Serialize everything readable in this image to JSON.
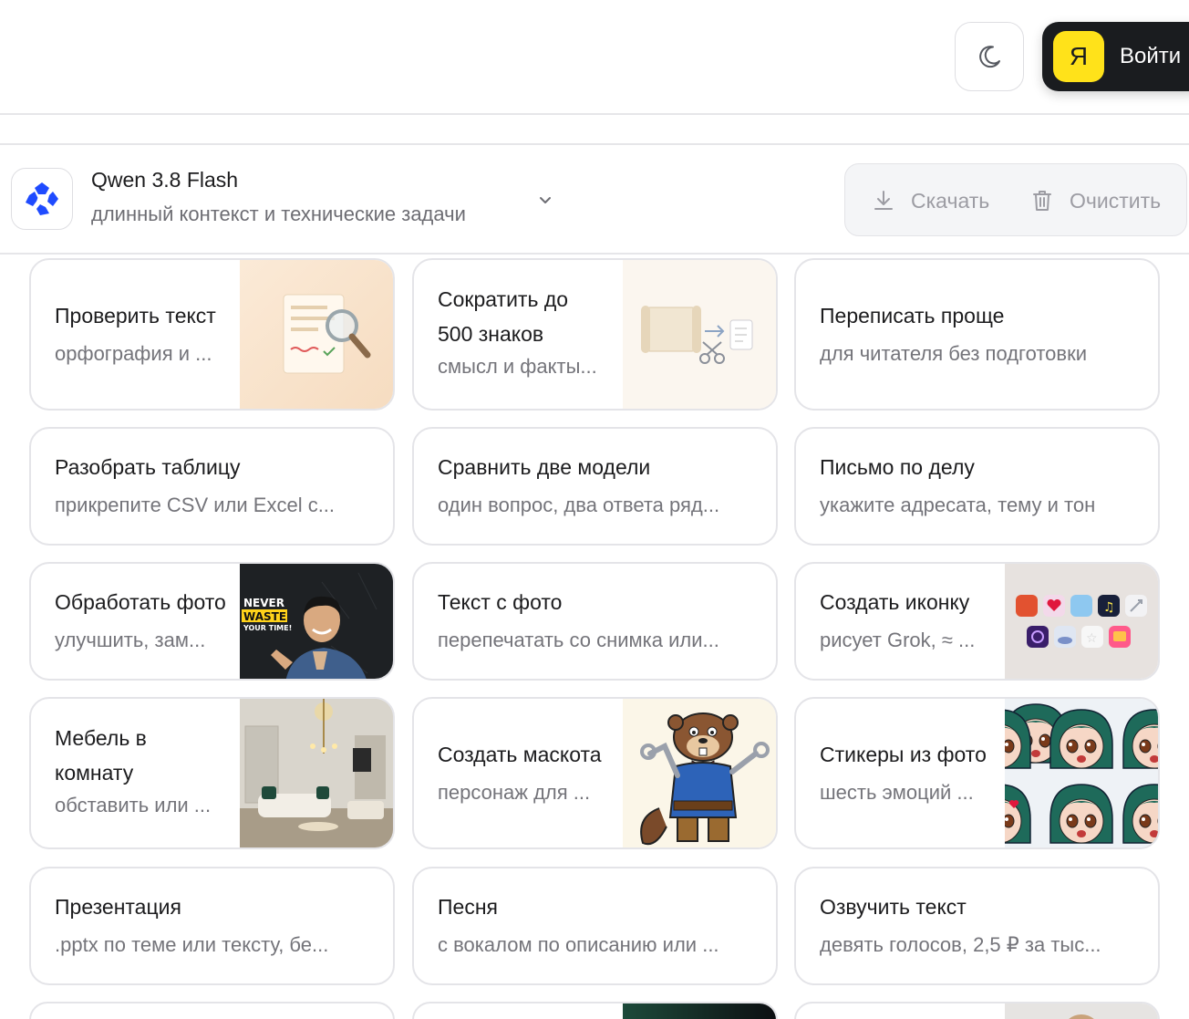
{
  "header": {
    "theme_icon": "moon-icon",
    "login": {
      "badge": "Я",
      "label": "Войти"
    }
  },
  "model": {
    "logo_icon": "qwen-logo-icon",
    "name": "Qwen 3.8 Flash",
    "description": "длинный контекст и технические задачи",
    "chevron_icon": "chevron-down-icon"
  },
  "actions": {
    "download_label": "Скачать",
    "clear_label": "Очистить"
  },
  "cards": [
    {
      "title": "Проверить текст",
      "subtitle": "орфография и ...",
      "thumb": "document-magnifier"
    },
    {
      "title": "Сократить до 500 знаков",
      "subtitle": "смысл и факты...",
      "thumb": "scroll-scissors"
    },
    {
      "title": "Переписать проще",
      "subtitle": "для читателя без подготовки"
    },
    {
      "title": "Разобрать таблицу",
      "subtitle": "прикрепите CSV или Excel с..."
    },
    {
      "title": "Сравнить две модели",
      "subtitle": "один вопрос, два ответа ряд..."
    },
    {
      "title": "Письмо по делу",
      "subtitle": "укажите адресата, тему и тон"
    },
    {
      "title": "Обработать фото",
      "subtitle": "улучшить, зам...",
      "thumb": "photo-person",
      "thumb_text": [
        "NEVER",
        "WASTE",
        "YOUR TIME!"
      ]
    },
    {
      "title": "Текст с фото",
      "subtitle": "перепечатать со снимка или..."
    },
    {
      "title": "Создать иконку",
      "subtitle": "рисует Grok, ≈ ...",
      "thumb": "app-icons"
    },
    {
      "title": "Мебель в комнату",
      "subtitle": "обставить или ...",
      "thumb": "interior-room"
    },
    {
      "title": "Создать маскота",
      "subtitle": "персонаж для ...",
      "thumb": "beaver-mascot"
    },
    {
      "title": "Стикеры из фото",
      "subtitle": "шесть эмоций ...",
      "thumb": "anime-stickers"
    },
    {
      "title": "Презентация",
      "subtitle": ".pptx по теме или тексту, бе..."
    },
    {
      "title": "Песня",
      "subtitle": "с вокалом по описанию или ..."
    },
    {
      "title": "Озвучить текст",
      "subtitle": "девять голосов, 2,5 ₽ за тыс..."
    }
  ],
  "colors": {
    "accent_blue": "#1f4bff",
    "login_bg": "#1a1c1f",
    "ya_yellow": "#ffe21a",
    "border": "#e4e4e8"
  }
}
